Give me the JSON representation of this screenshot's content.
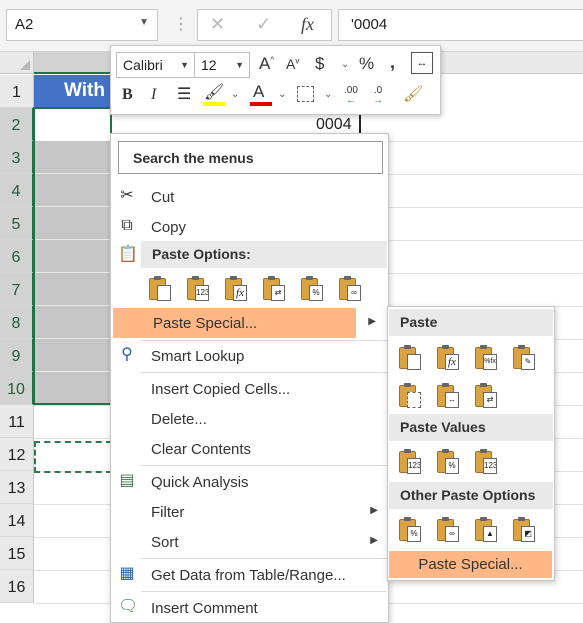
{
  "formula_bar": {
    "name_box": "A2",
    "cancel_icon": "✕",
    "enter_icon": "✓",
    "fx_label": "fx",
    "content": "'0004"
  },
  "column_headers": {
    "a": ""
  },
  "row_headers": [
    "1",
    "2",
    "3",
    "4",
    "5",
    "6",
    "7",
    "8",
    "9",
    "10",
    "11",
    "12",
    "13",
    "14",
    "15",
    "16"
  ],
  "sheet": {
    "a1_text": "With",
    "editing_value": "0004"
  },
  "mini_toolbar": {
    "font_name": "Calibri",
    "font_size": "12",
    "grow_font": "A",
    "shrink_font": "A",
    "currency": "$",
    "percent": "%",
    "comma": ",",
    "bold": "B",
    "italic": "I",
    "font_color_letter": "A",
    "increase_decimal": ".00",
    "decrease_decimal": ".0",
    "fill_color": "#ffff00",
    "font_color": "#e00000"
  },
  "context_menu": {
    "search_placeholder": "Search the menus",
    "items": {
      "cut": "Cut",
      "copy": "Copy",
      "paste_options_header": "Paste Options:",
      "paste_special": "Paste Special...",
      "smart_lookup": "Smart Lookup",
      "insert_copied_cells": "Insert Copied Cells...",
      "delete": "Delete...",
      "clear_contents": "Clear Contents",
      "quick_analysis": "Quick Analysis",
      "filter": "Filter",
      "sort": "Sort",
      "get_data": "Get Data from Table/Range...",
      "insert_comment": "Insert Comment"
    },
    "paste_option_icon_labels": [
      "",
      "123",
      "fx",
      "",
      "%",
      ""
    ]
  },
  "submenu": {
    "paste_header": "Paste",
    "paste_values_header": "Paste Values",
    "other_header": "Other Paste Options",
    "paste_special": "Paste Special...",
    "icon_labels": {
      "formulas": "fx",
      "formulas_number": "%fx",
      "value": "123",
      "value_number": "%",
      "value_source": "123",
      "formatting": "%"
    }
  },
  "colors": {
    "header_fill": "#4472c4",
    "selection": "#217346",
    "hover": "#ffb785",
    "menu_group": "#e9e9e9"
  }
}
